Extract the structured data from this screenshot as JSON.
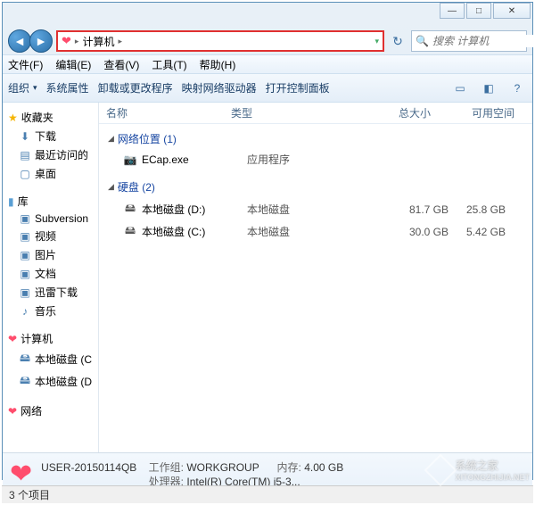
{
  "window_controls": {
    "min": "—",
    "max": "□",
    "close": "✕"
  },
  "address": {
    "root": "计算机",
    "sep": "▸",
    "dropdown": "▾"
  },
  "search": {
    "placeholder": "搜索 计算机"
  },
  "menubar": [
    "文件(F)",
    "编辑(E)",
    "查看(V)",
    "工具(T)",
    "帮助(H)"
  ],
  "toolbar": {
    "organize": "组织",
    "properties": "系统属性",
    "uninstall": "卸载或更改程序",
    "mapdrive": "映射网络驱动器",
    "controlpanel": "打开控制面板"
  },
  "sidebar": {
    "favorites": {
      "label": "收藏夹",
      "items": [
        "下载",
        "最近访问的",
        "桌面"
      ]
    },
    "libraries": {
      "label": "库",
      "items": [
        "Subversion",
        "视频",
        "图片",
        "文档",
        "迅雷下载",
        "音乐"
      ]
    },
    "computer": {
      "label": "计算机",
      "items": [
        "本地磁盘 (C",
        "本地磁盘 (D"
      ]
    },
    "network": {
      "label": "网络"
    }
  },
  "columns": {
    "name": "名称",
    "type": "类型",
    "total": "总大小",
    "free": "可用空间"
  },
  "sections": {
    "netloc": {
      "title": "网络位置 (1)",
      "items": [
        {
          "icon": "📷",
          "name": "ECap.exe",
          "type": "应用程序",
          "total": "",
          "free": ""
        }
      ]
    },
    "disks": {
      "title": "硬盘 (2)",
      "items": [
        {
          "icon": "🖴",
          "name": "本地磁盘 (D:)",
          "type": "本地磁盘",
          "total": "81.7 GB",
          "free": "25.8 GB"
        },
        {
          "icon": "🖴",
          "name": "本地磁盘 (C:)",
          "type": "本地磁盘",
          "total": "30.0 GB",
          "free": "5.42 GB"
        }
      ]
    }
  },
  "details": {
    "title": "USER-20150114QB",
    "workgroup_label": "工作组:",
    "workgroup": "WORKGROUP",
    "memory_label": "内存:",
    "memory": "4.00 GB",
    "cpu_label": "处理器:",
    "cpu": "Intel(R) Core(TM) i5-3..."
  },
  "status": "3 个项目",
  "watermark": {
    "line1": "系统之家",
    "line2": "XITONGZHIJIA.NET"
  }
}
